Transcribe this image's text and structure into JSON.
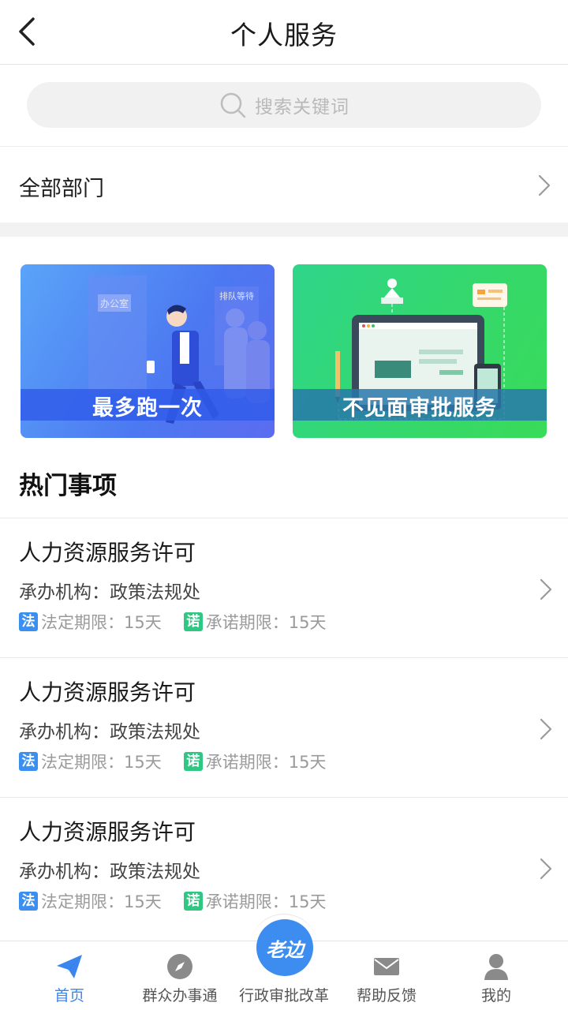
{
  "header": {
    "title": "个人服务",
    "back_icon": "chevron-left-icon"
  },
  "search": {
    "placeholder": "搜索关键词",
    "icon": "search-icon"
  },
  "department": {
    "label": "全部部门",
    "icon": "chevron-right-icon"
  },
  "banners": [
    {
      "label": "最多跑一次",
      "sign_office": "办公室",
      "sign_queue": "排队等待",
      "color": "#4c78f1"
    },
    {
      "label": "不见面审批服务",
      "color": "#35d86a"
    }
  ],
  "hot": {
    "title": "热门事项",
    "items": [
      {
        "title": "人力资源服务许可",
        "org": "承办机构：政策法规处",
        "tag_legal": "法",
        "legal_limit": "法定期限：15天",
        "tag_promise": "诺",
        "promise_limit": "承诺期限：15天"
      },
      {
        "title": "人力资源服务许可",
        "org": "承办机构：政策法规处",
        "tag_legal": "法",
        "legal_limit": "法定期限：15天",
        "tag_promise": "诺",
        "promise_limit": "承诺期限：15天"
      },
      {
        "title": "人力资源服务许可",
        "org": "承办机构：政策法规处",
        "tag_legal": "法",
        "legal_limit": "法定期限：15天",
        "tag_promise": "诺",
        "promise_limit": "承诺期限：15天"
      }
    ]
  },
  "tabbar": {
    "items": [
      {
        "label": "首页",
        "icon": "paper-plane-icon",
        "active": true
      },
      {
        "label": "群众办事通",
        "icon": "compass-icon"
      },
      {
        "label": "行政审批改革",
        "icon": "laobian-logo",
        "center_text": "老边"
      },
      {
        "label": "帮助反馈",
        "icon": "mail-icon"
      },
      {
        "label": "我的",
        "icon": "user-icon"
      }
    ]
  },
  "colors": {
    "accent": "#3a86ee",
    "legal_tag": "#3a8ff0",
    "promise_tag": "#2ec883"
  }
}
